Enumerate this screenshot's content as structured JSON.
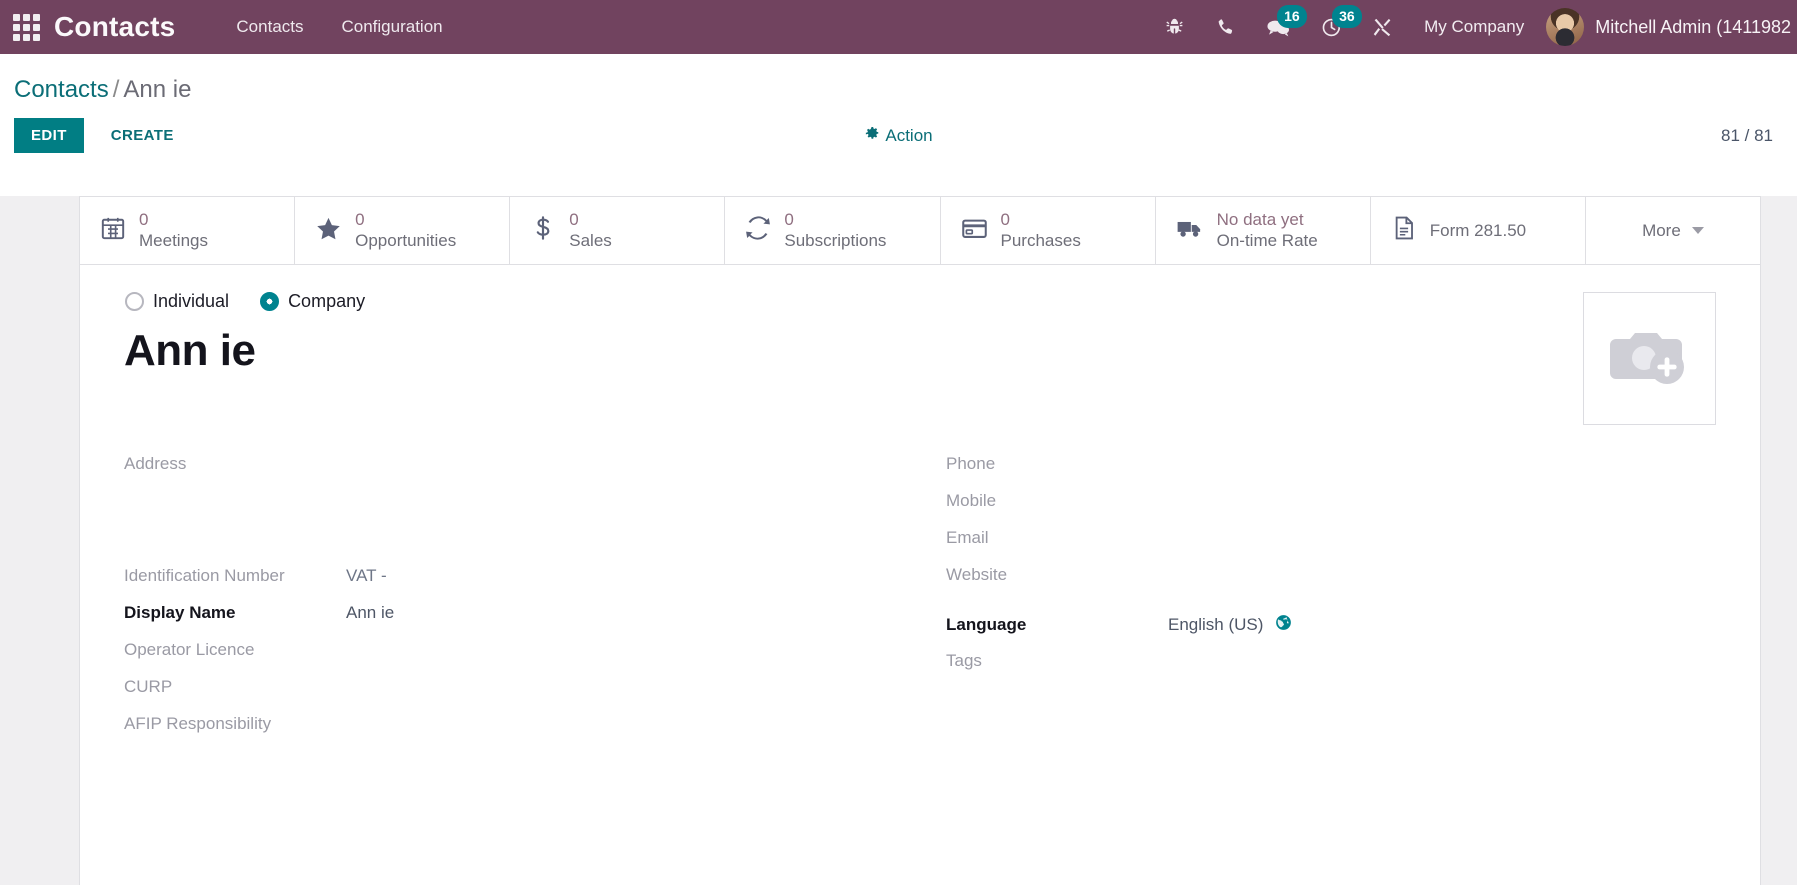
{
  "navbar": {
    "apps_icon": "apps-grid-icon",
    "brand": "Contacts",
    "menus": [
      {
        "label": "Contacts"
      },
      {
        "label": "Configuration"
      }
    ],
    "icons": [
      {
        "name": "bug-icon",
        "badge": null
      },
      {
        "name": "phone-icon",
        "badge": null
      },
      {
        "name": "messages-icon",
        "badge": "16"
      },
      {
        "name": "activity-clock-icon",
        "badge": "36"
      },
      {
        "name": "tools-icon",
        "badge": null
      }
    ],
    "company": "My Company",
    "user": "Mitchell Admin (1411982"
  },
  "control_panel": {
    "breadcrumb_root": "Contacts",
    "breadcrumb_sep": "/",
    "breadcrumb_current": "Ann ie",
    "edit_label": "EDIT",
    "create_label": "CREATE",
    "action_label": "Action",
    "pager": "81 / 81"
  },
  "stat_buttons": [
    {
      "icon": "calendar-icon",
      "value": "0",
      "label": "Meetings"
    },
    {
      "icon": "star-icon",
      "value": "0",
      "label": "Opportunities"
    },
    {
      "icon": "dollar-icon",
      "value": "0",
      "label": "Sales"
    },
    {
      "icon": "refresh-icon",
      "value": "0",
      "label": "Subscriptions"
    },
    {
      "icon": "credit-card-icon",
      "value": "0",
      "label": "Purchases"
    },
    {
      "icon": "truck-icon",
      "value": "No data yet",
      "label": "On-time Rate"
    },
    {
      "icon": "document-icon",
      "value": "",
      "label": "Form 281.50"
    }
  ],
  "more_button": {
    "label": "More",
    "icon": "chevron-down-icon"
  },
  "form": {
    "type_options": [
      {
        "label": "Individual",
        "selected": false
      },
      {
        "label": "Company",
        "selected": true
      }
    ],
    "record_name": "Ann ie",
    "image_placeholder_icon": "camera-add-icon",
    "left_fields": [
      {
        "label": "Address",
        "value": "",
        "bold": false,
        "tall": true
      },
      {
        "label": "Identification Number",
        "value": "VAT -",
        "bold": false,
        "tall": false
      },
      {
        "label": "Display Name",
        "value": "Ann ie",
        "bold": true,
        "tall": false
      },
      {
        "label": "Operator Licence",
        "value": "",
        "bold": false,
        "tall": false
      },
      {
        "label": "CURP",
        "value": "",
        "bold": false,
        "tall": false
      },
      {
        "label": "AFIP Responsibility",
        "value": "",
        "bold": false,
        "tall": false
      }
    ],
    "right_fields": [
      {
        "label": "Phone",
        "value": "",
        "bold": false
      },
      {
        "label": "Mobile",
        "value": "",
        "bold": false
      },
      {
        "label": "Email",
        "value": "",
        "bold": false
      },
      {
        "label": "Website",
        "value": "",
        "bold": false
      },
      {
        "label": "Language",
        "value": "English (US)",
        "bold": true,
        "icon": "globe-icon"
      },
      {
        "label": "Tags",
        "value": "",
        "bold": false
      }
    ]
  },
  "colors": {
    "navbar_bg": "#71435f",
    "accent_teal": "#00838f",
    "edit_button": "#017e84",
    "link": "#0b6e77",
    "sheet_bg": "#f0eff1"
  }
}
